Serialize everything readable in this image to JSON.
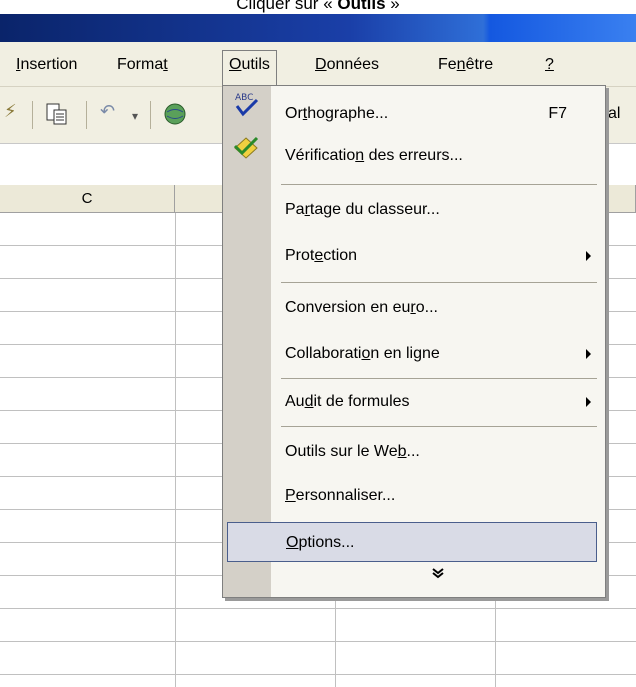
{
  "caption": {
    "prefix": "Cliquer sur ",
    "open_quote": "« ",
    "bold": "Outils",
    "close_quote": " »"
  },
  "menubar": {
    "items": [
      {
        "pre": "",
        "u": "I",
        "post": "nsertion"
      },
      {
        "pre": "Forma",
        "u": "t",
        "post": ""
      },
      {
        "pre": "",
        "u": "O",
        "post": "utils"
      },
      {
        "pre": "",
        "u": "D",
        "post": "onnées"
      },
      {
        "pre": "Fe",
        "u": "n",
        "post": "être"
      },
      {
        "pre": "",
        "u": "?",
        "post": ""
      }
    ]
  },
  "toolbar": {
    "partial_text": "al"
  },
  "grid": {
    "col_c_label": "C"
  },
  "dropdown": {
    "items": [
      {
        "pre": "Or",
        "u": "t",
        "post": "hographe...",
        "shortcut": "F7",
        "icon": "spellcheck-icon"
      },
      {
        "pre": "Vérificatio",
        "u": "n",
        "post": " des erreurs...",
        "icon": "error-check-icon"
      },
      {
        "pre": "Pa",
        "u": "r",
        "post": "tage du classeur..."
      },
      {
        "pre": "Prot",
        "u": "e",
        "post": "ction",
        "submenu": true
      },
      {
        "pre": "Conversion en eu",
        "u": "r",
        "post": "o..."
      },
      {
        "pre": "Collaborati",
        "u": "o",
        "post": "n en ligne",
        "submenu": true
      },
      {
        "pre": "Au",
        "u": "d",
        "post": "it de formules",
        "submenu": true
      },
      {
        "pre": "Outils sur le We",
        "u": "b",
        "post": "..."
      },
      {
        "pre": "",
        "u": "P",
        "post": "ersonnaliser..."
      },
      {
        "pre": "",
        "u": "O",
        "post": "ptions..."
      }
    ],
    "more_glyph": "¥"
  },
  "colors": {
    "menu_bg": "#f1efe2",
    "gutter": "#d4d0c8",
    "highlight": "#d9dbe6",
    "title_blue": "#0a246a"
  }
}
